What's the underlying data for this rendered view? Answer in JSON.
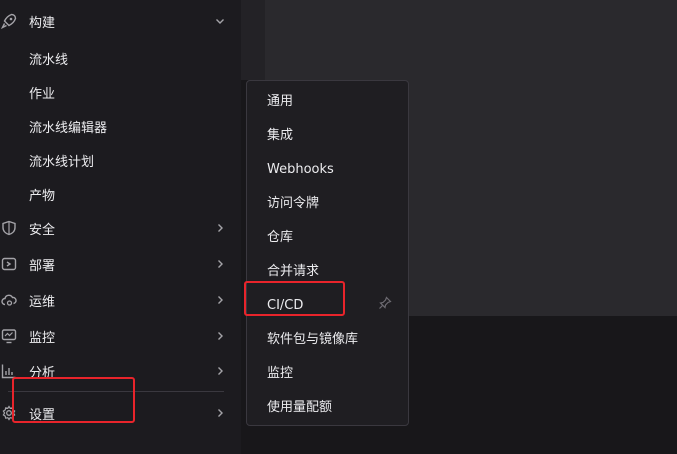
{
  "sidebar": {
    "build": {
      "label": "构建",
      "icon": "rocket-icon"
    },
    "sub_items": [
      {
        "label": "流水线"
      },
      {
        "label": "作业"
      },
      {
        "label": "流水线编辑器"
      },
      {
        "label": "流水线计划"
      },
      {
        "label": "产物"
      }
    ],
    "items": [
      {
        "label": "安全",
        "icon": "shield-icon"
      },
      {
        "label": "部署",
        "icon": "deploy-icon"
      },
      {
        "label": "运维",
        "icon": "cloud-gear-icon"
      },
      {
        "label": "监控",
        "icon": "monitor-icon"
      },
      {
        "label": "分析",
        "icon": "chart-icon"
      },
      {
        "label": "设置",
        "icon": "gear-icon"
      }
    ]
  },
  "settings_menu": {
    "items": [
      {
        "label": "通用"
      },
      {
        "label": "集成"
      },
      {
        "label": "Webhooks"
      },
      {
        "label": "访问令牌"
      },
      {
        "label": "仓库"
      },
      {
        "label": "合并请求"
      },
      {
        "label": "CI/CD"
      },
      {
        "label": "软件包与镜像库"
      },
      {
        "label": "监控"
      },
      {
        "label": "使用量配额"
      }
    ]
  },
  "colors": {
    "highlight": "#e8242b",
    "text": "#ececef"
  }
}
